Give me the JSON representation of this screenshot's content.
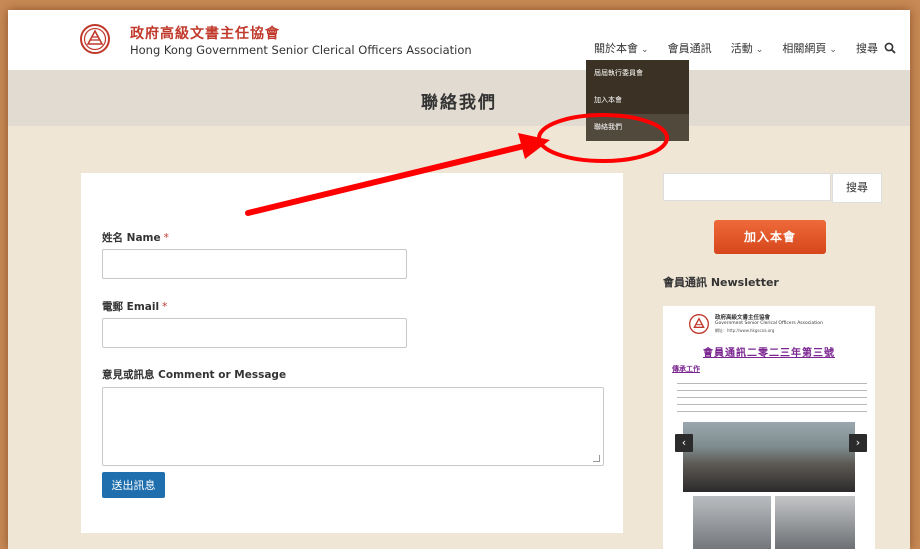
{
  "header": {
    "org_name_zh": "政府高級文書主任協會",
    "org_name_en": "Hong Kong Government Senior Clerical Officers Association"
  },
  "nav": {
    "items": [
      {
        "label": "關於本會",
        "has_dropdown": true
      },
      {
        "label": "會員通訊",
        "has_dropdown": false
      },
      {
        "label": "活動",
        "has_dropdown": true
      },
      {
        "label": "相關網頁",
        "has_dropdown": true
      }
    ],
    "search_label": "搜尋"
  },
  "dropdown": {
    "items": [
      {
        "label": "屆屆執行委員會",
        "active": false
      },
      {
        "label": "加入本會",
        "active": false
      },
      {
        "label": "聯絡我們",
        "active": true
      }
    ]
  },
  "page": {
    "title": "聯絡我們"
  },
  "form": {
    "name_label": "姓名 Name",
    "email_label": "電郵 Email",
    "message_label": "意見或訊息 Comment or Message",
    "required_mark": "*",
    "name_value": "",
    "email_value": "",
    "message_value": "",
    "submit_label": "送出訊息"
  },
  "sidebar": {
    "search_button_label": "搜尋",
    "join_button_label": "加入本會",
    "newsletter_heading": "會員通訊 Newsletter",
    "newsletter": {
      "org_zh": "政府高級文書主任協會",
      "org_en": "Government Senior Clerical Officers Association",
      "url": "網址：http://www.hkgscoa.org",
      "issue_title": "會員通訊二零二三年第三號",
      "section_title": "傳承工作",
      "prev_label": "‹",
      "next_label": "›"
    }
  },
  "colors": {
    "brand_red": "#c0392b",
    "nav_dropdown_bg": "#3b3225",
    "join_orange": "#e8572a",
    "submit_blue": "#1f6fae",
    "annotation_red": "#ff0000",
    "newsletter_purple": "#7b2590"
  }
}
